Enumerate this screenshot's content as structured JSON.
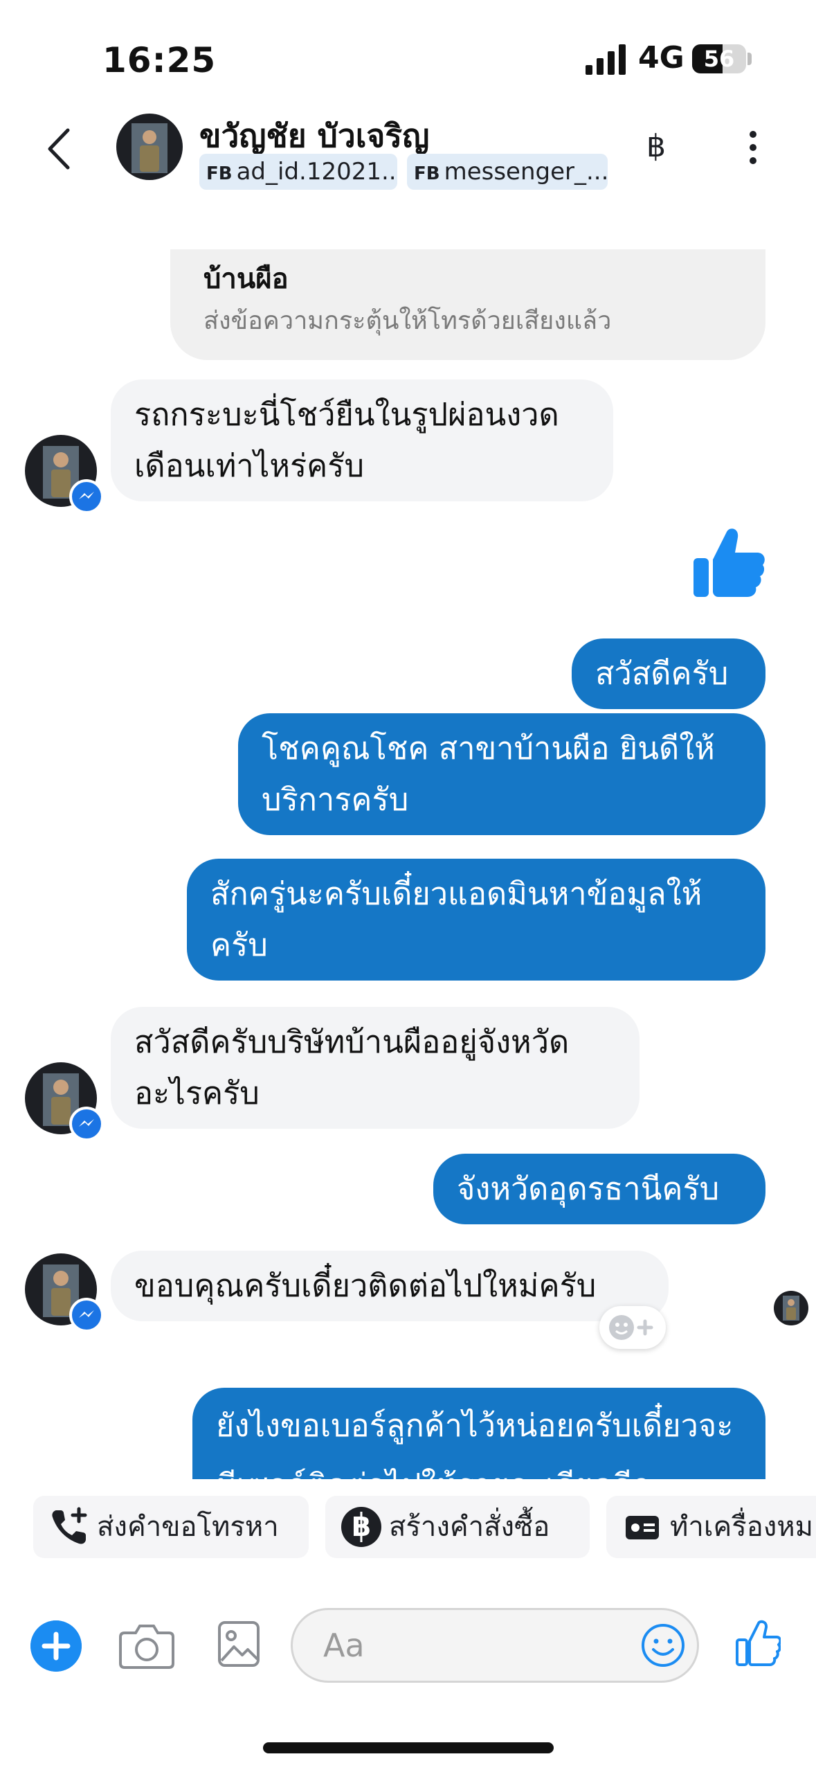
{
  "status_bar": {
    "time": "16:25",
    "network": "4G",
    "battery": "56",
    "battery_level": 0.56
  },
  "header": {
    "contact_name": "ขวัญชัย บัวเจริญ",
    "tags": [
      {
        "prefix": "FB",
        "label": "ad_id.12021..."
      },
      {
        "prefix": "FB",
        "label": "messenger_..."
      }
    ],
    "currency_symbol": "฿"
  },
  "system_notice": {
    "title": "บ้านผือ",
    "subtitle": "ส่งข้อความกระตุ้นให้โทรด้วยเสียงแล้ว"
  },
  "messages": [
    {
      "direction": "in",
      "text": "รถกระบะนี่โชว์ยืนในรูปผ่อนงวดเดือนเท่าไหร่ครับ"
    },
    {
      "direction": "out",
      "type": "thumbs-up"
    },
    {
      "direction": "out",
      "text": "สวัสดีครับ"
    },
    {
      "direction": "out",
      "text": "โชคคูณโชค สาขาบ้านผือ ยินดีให้บริการครับ"
    },
    {
      "direction": "out",
      "text": "สักครู่นะครับเดี๋ยวแอดมินหาข้อมูลให้ครับ"
    },
    {
      "direction": "in",
      "text": "สวัสดีครับบริษัทบ้านผืออยู่จังหวัดอะไรครับ"
    },
    {
      "direction": "out",
      "text": "จังหวัดอุดรธานีครับ"
    },
    {
      "direction": "in",
      "text": "ขอบคุณครับเดี๋ยวติดต่อไปใหม่ครับ"
    },
    {
      "direction": "out",
      "text": "ยังไงขอเบอร์ลูกค้าไว้หน่อยครับเดี๋ยวจะมีเซลล์ติดต่อไปให้รายละเอียดอีก"
    }
  ],
  "quick_actions": [
    {
      "label": "ส่งคำขอโทรหา",
      "icon": "phone-plus-icon"
    },
    {
      "label": "สร้างคำสั่งซื้อ",
      "icon": "baht-circle-icon"
    },
    {
      "label": "ทำเครื่องหม",
      "icon": "id-card-icon"
    }
  ],
  "composer": {
    "placeholder": "Aa"
  },
  "colors": {
    "outgoing_bubble": "#1577c6",
    "incoming_bubble": "#f3f4f6",
    "accent": "#1b8cf2"
  }
}
